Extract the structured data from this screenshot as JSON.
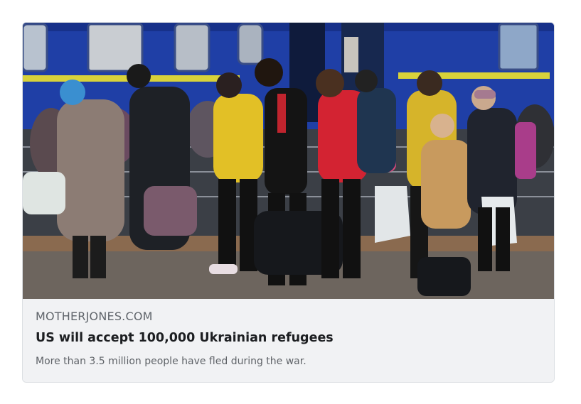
{
  "link_preview": {
    "domain": "MOTHERJONES.COM",
    "title": "US will accept 100,000 Ukrainian refugees",
    "description": "More than 3.5 million people have fled during the war.",
    "image_alt": "Refugees with bags walking past a blue train on a station platform"
  },
  "colors": {
    "card_background": "#f1f2f4",
    "train_blue": "#1f3fa6",
    "train_stripe": "#d8d23a"
  }
}
